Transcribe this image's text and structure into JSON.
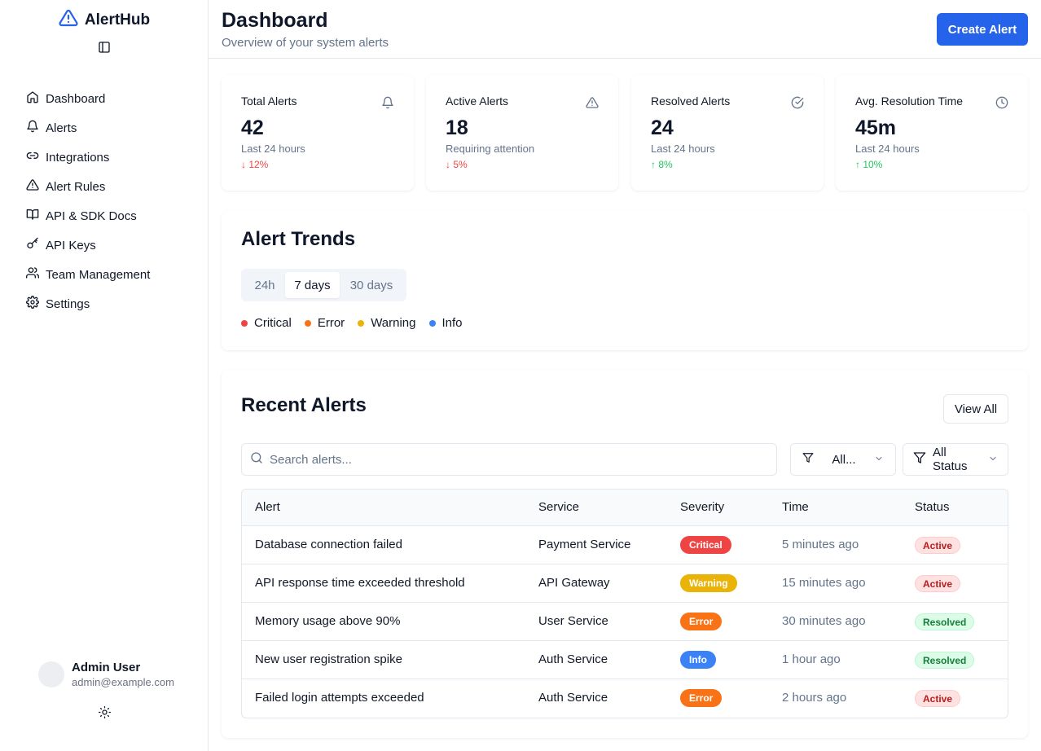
{
  "app": {
    "name": "AlertHub"
  },
  "sidebar": {
    "items": [
      {
        "label": "Dashboard",
        "icon": "home-icon"
      },
      {
        "label": "Alerts",
        "icon": "bell-icon"
      },
      {
        "label": "Integrations",
        "icon": "link-icon"
      },
      {
        "label": "Alert Rules",
        "icon": "warning-triangle-icon"
      },
      {
        "label": "API & SDK Docs",
        "icon": "book-icon"
      },
      {
        "label": "API Keys",
        "icon": "key-icon"
      },
      {
        "label": "Team Management",
        "icon": "users-icon"
      },
      {
        "label": "Settings",
        "icon": "gear-icon"
      }
    ],
    "user": {
      "name": "Admin User",
      "email": "admin@example.com"
    }
  },
  "header": {
    "title": "Dashboard",
    "subtitle": "Overview of your system alerts",
    "create_label": "Create Alert"
  },
  "stats": [
    {
      "label": "Total Alerts",
      "value": "42",
      "sub": "Last 24 hours",
      "change": "↓ 12%",
      "trend": "down",
      "icon": "bell-icon"
    },
    {
      "label": "Active Alerts",
      "value": "18",
      "sub": "Requiring attention",
      "change": "↓ 5%",
      "trend": "down",
      "icon": "warning-triangle-icon"
    },
    {
      "label": "Resolved Alerts",
      "value": "24",
      "sub": "Last 24 hours",
      "change": "↑ 8%",
      "trend": "up",
      "icon": "check-circle-icon"
    },
    {
      "label": "Avg. Resolution Time",
      "value": "45m",
      "sub": "Last 24 hours",
      "change": "↑ 10%",
      "trend": "up",
      "icon": "clock-icon"
    }
  ],
  "trends": {
    "title": "Alert Trends",
    "tabs": [
      "24h",
      "7 days",
      "30 days"
    ],
    "active_tab": "7 days",
    "legend": [
      {
        "label": "Critical",
        "color": "#ef4444"
      },
      {
        "label": "Error",
        "color": "#f97316"
      },
      {
        "label": "Warning",
        "color": "#eab308"
      },
      {
        "label": "Info",
        "color": "#3b82f6"
      }
    ]
  },
  "recent": {
    "title": "Recent Alerts",
    "view_all_label": "View All",
    "search_placeholder": "Search alerts...",
    "severity_filter": "All...",
    "status_filter": "All Status",
    "columns": [
      "Alert",
      "Service",
      "Severity",
      "Time",
      "Status"
    ],
    "rows": [
      {
        "alert": "Database connection failed",
        "service": "Payment Service",
        "severity": "Critical",
        "time": "5 minutes ago",
        "status": "Active"
      },
      {
        "alert": "API response time exceeded threshold",
        "service": "API Gateway",
        "severity": "Warning",
        "time": "15 minutes ago",
        "status": "Active"
      },
      {
        "alert": "Memory usage above 90%",
        "service": "User Service",
        "severity": "Error",
        "time": "30 minutes ago",
        "status": "Resolved"
      },
      {
        "alert": "New user registration spike",
        "service": "Auth Service",
        "severity": "Info",
        "time": "1 hour ago",
        "status": "Resolved"
      },
      {
        "alert": "Failed login attempts exceeded",
        "service": "Auth Service",
        "severity": "Error",
        "time": "2 hours ago",
        "status": "Active"
      }
    ]
  },
  "colors": {
    "accent": "#2563eb",
    "critical": "#ef4444",
    "error": "#f97316",
    "warning": "#eab308",
    "info": "#3b82f6"
  }
}
